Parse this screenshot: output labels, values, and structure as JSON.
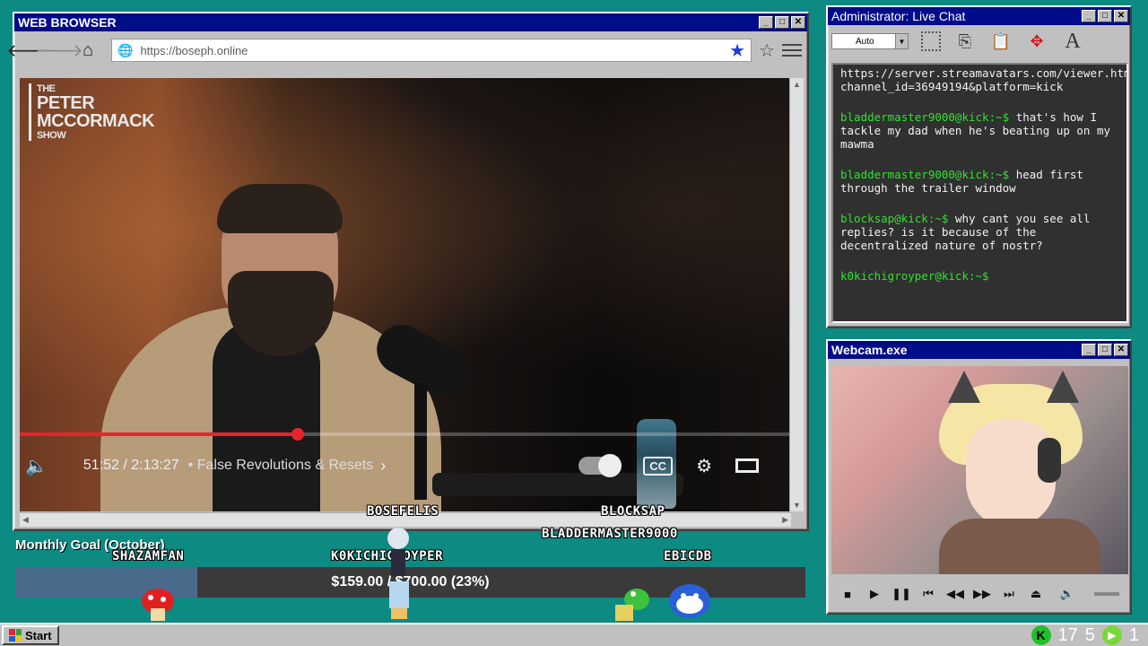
{
  "browser": {
    "title": "WEB BROWSER",
    "url": "https://boseph.online",
    "video": {
      "logo_line1": "THE",
      "logo_line2": "PETER",
      "logo_line3": "MCCORMACK",
      "logo_line4": "SHOW",
      "time": "51:52 / 2:13:27",
      "chapter": "• False Revolutions & Resets",
      "cc_label": "CC",
      "progress": 0.36
    }
  },
  "chat": {
    "title": "Administrator: Live Chat",
    "font_select": "Auto",
    "messages": [
      {
        "user": "",
        "text": "https://server.streamavatars.com/viewer.html?channel_id=36949194&platform=kick"
      },
      {
        "user": "bladdermaster9000@kick:~$",
        "text": "that's how I tackle my dad when he's beating up on my mawma"
      },
      {
        "user": "bladdermaster9000@kick:~$",
        "text": "head first through the trailer window"
      },
      {
        "user": "blocksap@kick:~$",
        "text": "why cant you see all replies? is it because of the decentralized nature of nostr?"
      },
      {
        "user": "k0kichigroyper@kick:~$",
        "text": ""
      }
    ]
  },
  "webcam": {
    "title": "Webcam.exe"
  },
  "overlay": {
    "goal_title": "Monthly Goal (October)",
    "goal_text": "$159.00 / $700.00 (23%)",
    "goal_fraction": 0.23,
    "viewers": [
      "SHAZAMFAN",
      "BOSEFELIS",
      "K0KICHIGROYPER",
      "BLOCKSAP",
      "BLADDERMASTER9000",
      "EBICDB"
    ]
  },
  "taskbar": {
    "start_label": "Start",
    "tray_count1": "17",
    "tray_count2": "5",
    "tray_count3": "1",
    "kick_label": "K"
  }
}
